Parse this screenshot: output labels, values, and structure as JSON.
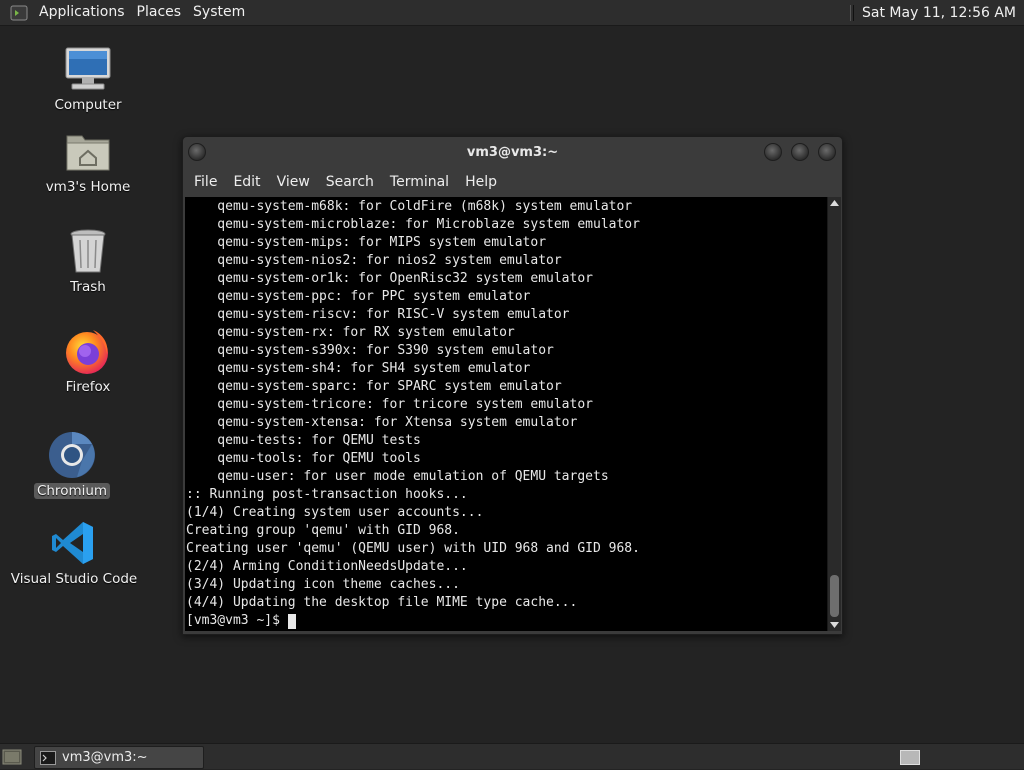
{
  "top_panel": {
    "menus": [
      "Applications",
      "Places",
      "System"
    ],
    "clock": "Sat May 11, 12:56 AM"
  },
  "desktop_icons": [
    {
      "label": "Computer",
      "icon": "computer-icon"
    },
    {
      "label": "vm3's Home",
      "icon": "home-folder-icon"
    },
    {
      "label": "Trash",
      "icon": "trash-icon"
    },
    {
      "label": "Firefox",
      "icon": "firefox-icon"
    },
    {
      "label": "Chromium",
      "icon": "chromium-icon"
    },
    {
      "label": "Visual Studio Code",
      "icon": "vscode-icon"
    }
  ],
  "terminal": {
    "title": "vm3@vm3:~",
    "menu": [
      "File",
      "Edit",
      "View",
      "Search",
      "Terminal",
      "Help"
    ],
    "lines": [
      "    qemu-system-m68k: for ColdFire (m68k) system emulator",
      "    qemu-system-microblaze: for Microblaze system emulator",
      "    qemu-system-mips: for MIPS system emulator",
      "    qemu-system-nios2: for nios2 system emulator",
      "    qemu-system-or1k: for OpenRisc32 system emulator",
      "    qemu-system-ppc: for PPC system emulator",
      "    qemu-system-riscv: for RISC-V system emulator",
      "    qemu-system-rx: for RX system emulator",
      "    qemu-system-s390x: for S390 system emulator",
      "    qemu-system-sh4: for SH4 system emulator",
      "    qemu-system-sparc: for SPARC system emulator",
      "    qemu-system-tricore: for tricore system emulator",
      "    qemu-system-xtensa: for Xtensa system emulator",
      "    qemu-tests: for QEMU tests",
      "    qemu-tools: for QEMU tools",
      "    qemu-user: for user mode emulation of QEMU targets",
      ":: Running post-transaction hooks...",
      "(1/4) Creating system user accounts...",
      "Creating group 'qemu' with GID 968.",
      "Creating user 'qemu' (QEMU user) with UID 968 and GID 968.",
      "(2/4) Arming ConditionNeedsUpdate...",
      "(3/4) Updating icon theme caches...",
      "(4/4) Updating the desktop file MIME type cache..."
    ],
    "prompt": "[vm3@vm3 ~]$ "
  },
  "taskbar": {
    "task_label": "vm3@vm3:~"
  }
}
